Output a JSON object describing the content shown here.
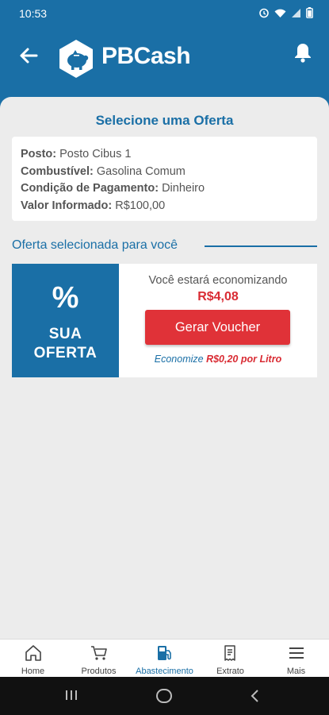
{
  "status_bar": {
    "time": "10:53"
  },
  "header": {
    "app_name": "PBCash"
  },
  "page": {
    "title": "Selecione uma Oferta"
  },
  "info": [
    {
      "label": "Posto:",
      "value": "Posto Cibus 1"
    },
    {
      "label": "Combustível:",
      "value": "Gasolina Comum"
    },
    {
      "label": "Condição de Pagamento:",
      "value": "Dinheiro"
    },
    {
      "label": "Valor Informado:",
      "value": "R$100,00"
    }
  ],
  "section": {
    "heading": "Oferta selecionada para você"
  },
  "offer": {
    "badge_symbol": "%",
    "badge_line1": "SUA",
    "badge_line2": "OFERTA",
    "savings_label": "Você estará economizando",
    "savings_value": "R$4,08",
    "button_label": "Gerar Voucher",
    "per_litre_prefix": "Economize ",
    "per_litre_value": "R$0,20 por Litro"
  },
  "bottom_nav": [
    {
      "label": "Home",
      "icon": "home-icon",
      "active": false
    },
    {
      "label": "Produtos",
      "icon": "cart-icon",
      "active": false
    },
    {
      "label": "Abastecimento",
      "icon": "fuel-pump-icon",
      "active": true
    },
    {
      "label": "Extrato",
      "icon": "receipt-icon",
      "active": false
    },
    {
      "label": "Mais",
      "icon": "menu-icon",
      "active": false
    }
  ],
  "colors": {
    "primary": "#1a6fa6",
    "accent_red": "#e03238",
    "background": "#ececec"
  }
}
